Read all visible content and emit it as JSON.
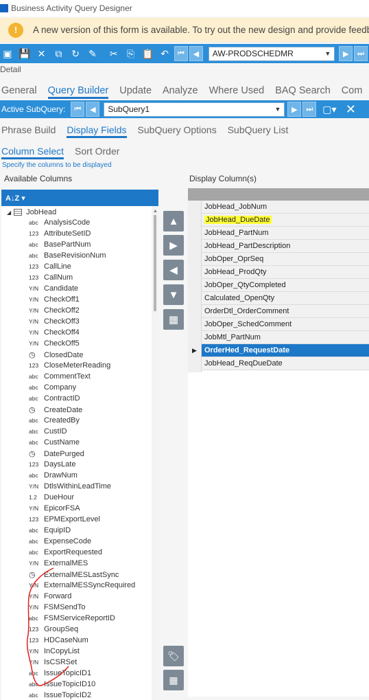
{
  "window": {
    "title": "Business Activity Query Designer"
  },
  "notification": {
    "text": "A new version of this form is available. To try out the new design and provide feedback"
  },
  "toolbar": {
    "icons": [
      "new-icon",
      "save-icon",
      "delete-icon",
      "copy-icon",
      "refresh-icon",
      "clear-icon",
      "cut-icon",
      "copy-icon",
      "paste-icon",
      "undo-icon"
    ],
    "query_id": "AW-PRODSCHEDMR"
  },
  "detail_label": "Detail",
  "main_tabs": [
    "General",
    "Query Builder",
    "Update",
    "Analyze",
    "Where Used",
    "BAQ Search",
    "Com"
  ],
  "main_active_tab": "Query Builder",
  "subquery_bar": {
    "label": "Active SubQuery:",
    "value": "SubQuery1"
  },
  "sub_tabs": [
    "Phrase Build",
    "Display Fields",
    "SubQuery Options",
    "SubQuery List"
  ],
  "sub_active_tab": "Display Fields",
  "inner_tabs": [
    "Column Select",
    "Sort Order"
  ],
  "inner_active_tab": "Column Select",
  "hint": "Specify the columns to be displayed",
  "available_label": "Available Columns",
  "display_label": "Display Column(s)",
  "tree": {
    "root": "JobHead",
    "items": [
      {
        "type": "abc",
        "name": "AnalysisCode"
      },
      {
        "type": "123",
        "name": "AttributeSetID"
      },
      {
        "type": "abc",
        "name": "BasePartNum"
      },
      {
        "type": "abc",
        "name": "BaseRevisionNum"
      },
      {
        "type": "123",
        "name": "CallLine"
      },
      {
        "type": "123",
        "name": "CallNum"
      },
      {
        "type": "Y/N",
        "name": "Candidate"
      },
      {
        "type": "Y/N",
        "name": "CheckOff1"
      },
      {
        "type": "Y/N",
        "name": "CheckOff2"
      },
      {
        "type": "Y/N",
        "name": "CheckOff3"
      },
      {
        "type": "Y/N",
        "name": "CheckOff4"
      },
      {
        "type": "Y/N",
        "name": "CheckOff5"
      },
      {
        "type": "date",
        "name": "ClosedDate"
      },
      {
        "type": "123",
        "name": "CloseMeterReading"
      },
      {
        "type": "abc",
        "name": "CommentText"
      },
      {
        "type": "abc",
        "name": "Company"
      },
      {
        "type": "abc",
        "name": "ContractID"
      },
      {
        "type": "date",
        "name": "CreateDate"
      },
      {
        "type": "abc",
        "name": "CreatedBy"
      },
      {
        "type": "abc",
        "name": "CustID"
      },
      {
        "type": "abc",
        "name": "CustName"
      },
      {
        "type": "date",
        "name": "DatePurged"
      },
      {
        "type": "123",
        "name": "DaysLate"
      },
      {
        "type": "abc",
        "name": "DrawNum"
      },
      {
        "type": "Y/N",
        "name": "DtlsWithinLeadTime"
      },
      {
        "type": "1.2",
        "name": "DueHour"
      },
      {
        "type": "Y/N",
        "name": "EpicorFSA"
      },
      {
        "type": "123",
        "name": "EPMExportLevel"
      },
      {
        "type": "abc",
        "name": "EquipID"
      },
      {
        "type": "abc",
        "name": "ExpenseCode"
      },
      {
        "type": "abc",
        "name": "ExportRequested"
      },
      {
        "type": "Y/N",
        "name": "ExternalMES"
      },
      {
        "type": "date",
        "name": "ExternalMESLastSync"
      },
      {
        "type": "Y/N",
        "name": "ExternalMESSyncRequired"
      },
      {
        "type": "Y/N",
        "name": "Forward"
      },
      {
        "type": "Y/N",
        "name": "FSMSendTo"
      },
      {
        "type": "abc",
        "name": "FSMServiceReportID"
      },
      {
        "type": "123",
        "name": "GroupSeq"
      },
      {
        "type": "123",
        "name": "HDCaseNum"
      },
      {
        "type": "Y/N",
        "name": "InCopyList"
      },
      {
        "type": "Y/N",
        "name": "IsCSRSet"
      },
      {
        "type": "abc",
        "name": "IssueTopicID1"
      },
      {
        "type": "abc",
        "name": "IssueTopicID10"
      },
      {
        "type": "abc",
        "name": "IssueTopicID2"
      }
    ]
  },
  "display_columns": [
    "JobHead_JobNum",
    "JobHead_DueDate",
    "JobHead_PartNum",
    "JobHead_PartDescription",
    "JobOper_OprSeq",
    "JobHead_ProdQty",
    "JobOper_QtyCompleted",
    "Calculated_OpenQty",
    "OrderDtl_OrderComment",
    "JobOper_SchedComment",
    "JobMtl_PartNum",
    "OrderHed_RequestDate",
    "JobHead_ReqDueDate"
  ],
  "selected_display_column": "OrderHed_RequestDate",
  "highlighted_display_column": "JobHead_DueDate",
  "colors": {
    "accent": "#1e78c8",
    "toolbar": "#2b8ed8",
    "highlight": "#ffff3a",
    "annotation": "#e0201c"
  }
}
